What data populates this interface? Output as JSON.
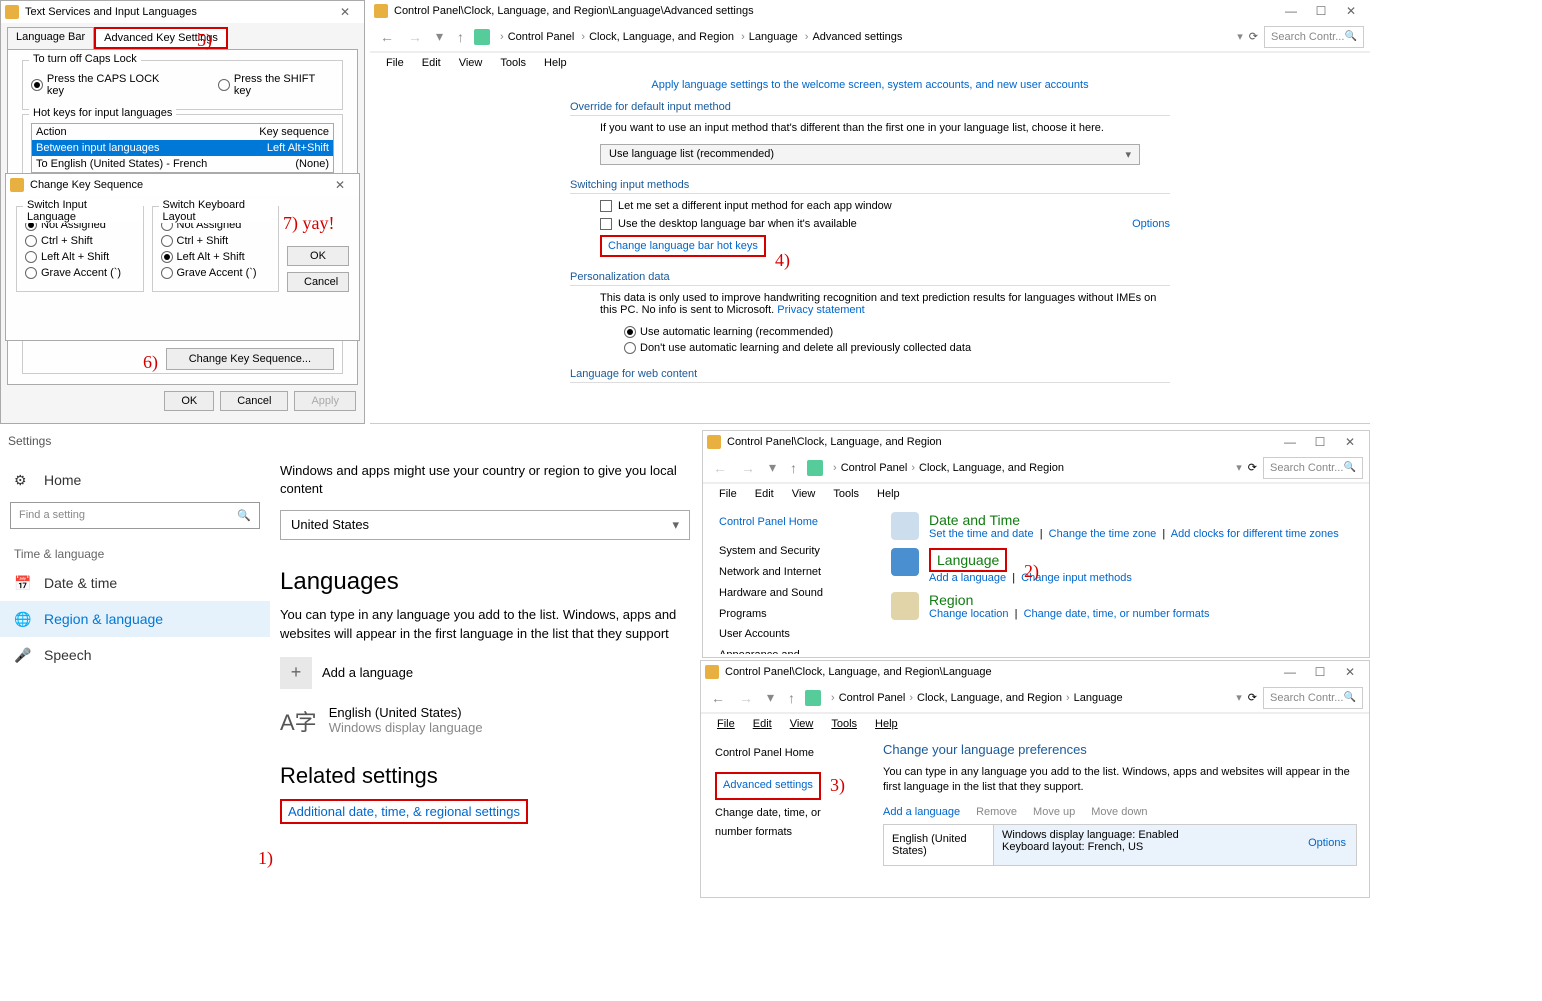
{
  "annotations": {
    "1": "1)",
    "2": "2)",
    "3": "3)",
    "4": "4)",
    "5": "5)",
    "6": "6)",
    "7": "7) yay!"
  },
  "tsil": {
    "title": "Text Services and Input Languages",
    "tabs": [
      "Language Bar",
      "Advanced Key Settings"
    ],
    "capslock_group": "To turn off Caps Lock",
    "capslock_opts": [
      "Press the CAPS LOCK key",
      "Press the SHIFT key"
    ],
    "hotkeys_group": "Hot keys for input languages",
    "cols": [
      "Action",
      "Key sequence"
    ],
    "rows": [
      {
        "action": "Between input languages",
        "seq": "Left Alt+Shift"
      },
      {
        "action": "To English (United States) - French",
        "seq": "(None)"
      }
    ],
    "change_btn": "Change Key Sequence...",
    "ok": "OK",
    "cancel": "Cancel",
    "apply": "Apply"
  },
  "cks": {
    "title": "Change Key Sequence",
    "g1": "Switch Input Language",
    "g2": "Switch Keyboard Layout",
    "opts": [
      "Not Assigned",
      "Ctrl + Shift",
      "Left Alt + Shift",
      "Grave Accent (`)"
    ],
    "ok": "OK",
    "cancel": "Cancel"
  },
  "adv": {
    "title": "Control Panel\\Clock, Language, and Region\\Language\\Advanced settings",
    "crumbs": [
      "Control Panel",
      "Clock, Language, and Region",
      "Language",
      "Advanced settings"
    ],
    "menus": [
      "File",
      "Edit",
      "View",
      "Tools",
      "Help"
    ],
    "welcome_link": "Apply language settings to the welcome screen, system accounts, and new user accounts",
    "sec1": "Override for default input method",
    "sec1_desc": "If you want to use an input method that's different than the first one in your language list, choose it here.",
    "sec1_sel": "Use language list (recommended)",
    "sec2": "Switching input methods",
    "sec2_cb1": "Let me set a different input method for each app window",
    "sec2_cb2": "Use the desktop language bar when it's available",
    "sec2_link": "Change language bar hot keys",
    "options": "Options",
    "sec3": "Personalization data",
    "sec3_desc": "This data is only used to improve handwriting recognition and text prediction results for languages without IMEs on this PC. No info is sent to Microsoft.",
    "privacy": "Privacy statement",
    "sec3_r1": "Use automatic learning (recommended)",
    "sec3_r2": "Don't use automatic learning and delete all previously collected data",
    "sec4": "Language for web content",
    "search_ph": "Search Contr..."
  },
  "settings": {
    "app": "Settings",
    "home": "Home",
    "find_ph": "Find a setting",
    "group": "Time & language",
    "items": [
      "Date & time",
      "Region & language",
      "Speech"
    ],
    "intro": "Windows and apps might use your country or region to give you local content",
    "country": "United States",
    "langs_h": "Languages",
    "langs_desc": "You can type in any language you add to the list. Windows, apps and websites will appear in the first language in the list that they support",
    "add_lang": "Add a language",
    "lang0": "English (United States)",
    "lang0_sub": "Windows display language",
    "related_h": "Related settings",
    "related_link": "Additional date, time, & regional settings"
  },
  "clr": {
    "title": "Control Panel\\Clock, Language, and Region",
    "crumbs": [
      "Control Panel",
      "Clock, Language, and Region"
    ],
    "menus": [
      "File",
      "Edit",
      "View",
      "Tools",
      "Help"
    ],
    "side": [
      "Control Panel Home",
      "System and Security",
      "Network and Internet",
      "Hardware and Sound",
      "Programs",
      "User Accounts",
      "Appearance and"
    ],
    "dt": "Date and Time",
    "dt_links": [
      "Set the time and date",
      "Change the time zone",
      "Add clocks for different time zones"
    ],
    "lang": "Language",
    "lang_links": [
      "Add a language",
      "Change input methods"
    ],
    "region": "Region",
    "region_links": [
      "Change location",
      "Change date, time, or number formats"
    ],
    "search_ph": "Search Contr..."
  },
  "langp": {
    "title": "Control Panel\\Clock, Language, and Region\\Language",
    "crumbs": [
      "Control Panel",
      "Clock, Language, and Region",
      "Language"
    ],
    "menus": [
      "File",
      "Edit",
      "View",
      "Tools",
      "Help"
    ],
    "side": [
      "Control Panel Home",
      "Advanced settings",
      "Change date, time, or number formats"
    ],
    "h": "Change your language preferences",
    "desc": "You can type in any language you add to the list. Windows, apps and websites will appear in the first language in the list that they support.",
    "tb": [
      "Add a language",
      "Remove",
      "Move up",
      "Move down"
    ],
    "lang0": "English (United States)",
    "lang0_d1": "Windows display language: Enabled",
    "lang0_d2": "Keyboard layout: French, US",
    "options": "Options",
    "search_ph": "Search Contr..."
  }
}
